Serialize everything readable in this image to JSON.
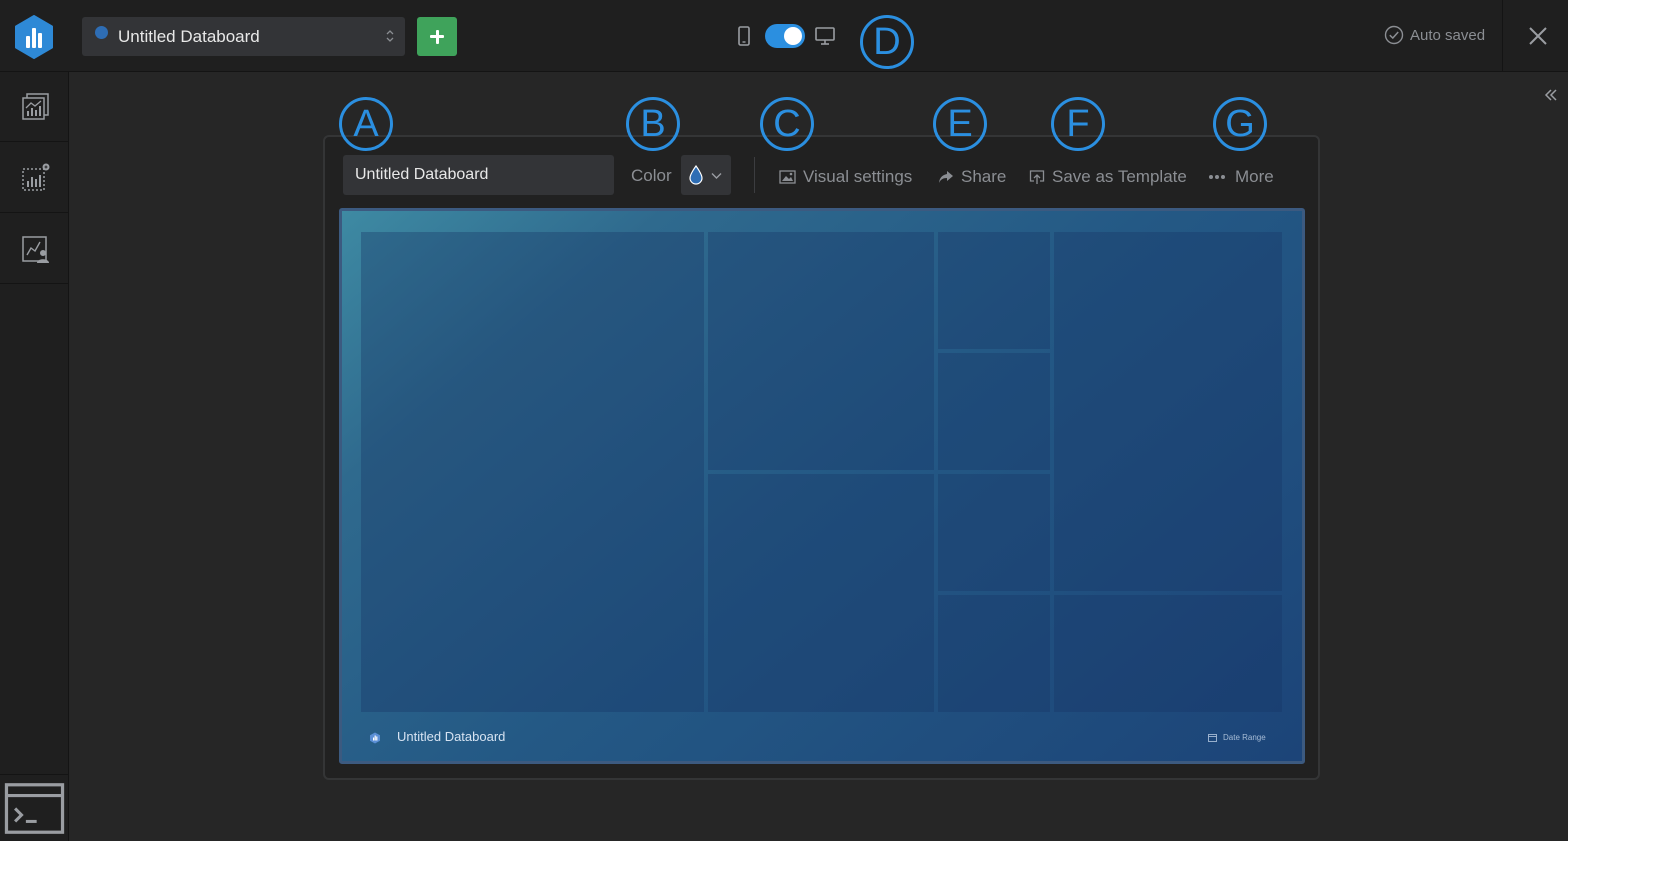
{
  "header": {
    "board_name": "Untitled Databoard",
    "autosave_status": "Auto saved",
    "layout_toggle": {
      "mode": "desktop",
      "on": true
    }
  },
  "toolbar": {
    "databoard_name_value": "Untitled Databoard",
    "color_label": "Color",
    "visual_settings_label": "Visual settings",
    "share_label": "Share",
    "save_template_label": "Save as Template",
    "more_label": "More"
  },
  "callouts": [
    "A",
    "B",
    "C",
    "D",
    "E",
    "F",
    "G"
  ],
  "preview": {
    "footer_title": "Untitled Databoard",
    "date_range_label": "Date Range"
  },
  "sidebar": {
    "items": [
      "metrics-library-icon",
      "add-visualization-icon",
      "user-metrics-icon"
    ],
    "bottom": "terminal-icon"
  },
  "colors": {
    "accent": "#2b8fe0",
    "add_button": "#3fa35b",
    "background": "#262626",
    "bars": "#1f1f1f",
    "preview_theme": "#245985"
  }
}
